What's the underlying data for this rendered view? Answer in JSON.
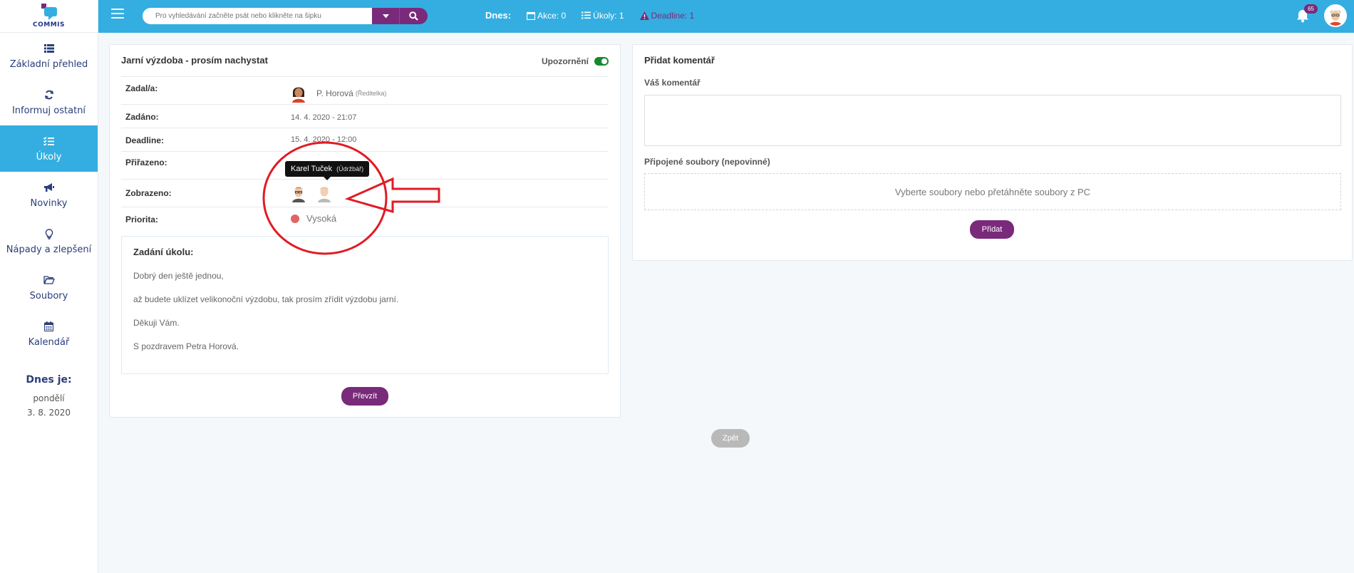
{
  "app": {
    "logo_text": "COMMIS"
  },
  "sidebar": {
    "items": [
      {
        "label": "Základní přehled",
        "icon": "list-icon",
        "active": false
      },
      {
        "label": "Informuj ostatní",
        "icon": "refresh-icon",
        "active": false
      },
      {
        "label": "Úkoly",
        "icon": "tasks-icon",
        "active": true
      },
      {
        "label": "Novinky",
        "icon": "megaphone-icon",
        "active": false
      },
      {
        "label": "Nápady a zlepšení",
        "icon": "lightbulb-icon",
        "active": false
      },
      {
        "label": "Soubory",
        "icon": "folder-icon",
        "active": false
      },
      {
        "label": "Kalendář",
        "icon": "calendar-icon",
        "active": false
      }
    ],
    "today": {
      "title": "Dnes je:",
      "day": "pondělí",
      "date": "3. 8. 2020"
    }
  },
  "topbar": {
    "search_placeholder": "Pro vyhledávání začněte psát nebo klikněte na šipku",
    "stats_label": "Dnes:",
    "stats": {
      "akce": "Akce: 0",
      "ukoly": "Úkoly: 1",
      "deadline": "Deadline: 1"
    },
    "notification_count": "65"
  },
  "task": {
    "title": "Jarní výzdoba - prosím nachystat",
    "notify_label": "Upozornění",
    "rows": {
      "assigned_by_label": "Zadal/a:",
      "assigned_by_name": "P. Horová",
      "assigned_by_role": "(Ředitelka)",
      "created_label": "Zadáno:",
      "created_value": "14. 4. 2020 - 21:07",
      "deadline_label": "Deadline:",
      "deadline_value": "15. 4. 2020 - 12:00",
      "assigned_to_label": "Přiřazeno:",
      "seen_label": "Zobrazeno:",
      "priority_label": "Priorita:",
      "priority_value": "Vysoká"
    },
    "description": {
      "title": "Zadání úkolu:",
      "lines": [
        "Dobrý den ještě jednou,",
        "až budete uklízet velikonoční výzdobu, tak prosím zřídit výzdobu jarní.",
        "Děkuji Vám.",
        "S pozdravem Petra Horová."
      ]
    },
    "take_button": "Převzít"
  },
  "tooltip": {
    "name": "Karel Tuček",
    "role": "(Údržbář)"
  },
  "comment": {
    "title": "Přidat komentář",
    "comment_label": "Váš komentář",
    "files_label": "Připojené soubory (nepovinné)",
    "dropzone_text": "Vyberte soubory nebo přetáhněte soubory z PC",
    "add_button": "Přidat"
  },
  "back_button": "Zpět",
  "colors": {
    "primary": "#34aee0",
    "accent": "#7a2a7a",
    "toggle_on": "#138a2e",
    "priority_high": "#e06464",
    "annotation": "#e01b24"
  }
}
